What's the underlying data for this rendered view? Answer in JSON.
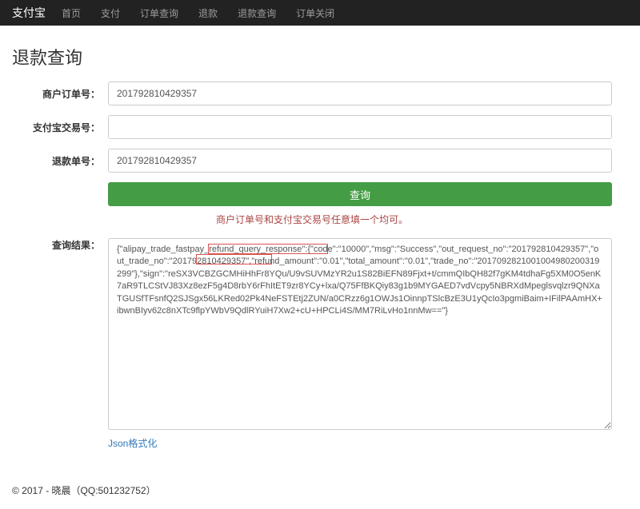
{
  "navbar": {
    "brand": "支付宝",
    "items": [
      {
        "label": "首页"
      },
      {
        "label": "支付"
      },
      {
        "label": "订单查询"
      },
      {
        "label": "退款"
      },
      {
        "label": "退款查询"
      },
      {
        "label": "订单关闭"
      }
    ]
  },
  "page": {
    "title": "退款查询"
  },
  "form": {
    "merchant_order_label": "商户订单号：",
    "merchant_order_value": "201792810429357",
    "alipay_trade_label": "支付宝交易号：",
    "alipay_trade_value": "",
    "refund_order_label": "退款单号：",
    "refund_order_value": "201792810429357",
    "submit_label": "查询",
    "hint": "商户订单号和支付宝交易号任意填一个均可。",
    "result_label": "查询结果：",
    "result_value": "{\"alipay_trade_fastpay_refund_query_response\":{\"code\":\"10000\",\"msg\":\"Success\",\"out_request_no\":\"201792810429357\",\"out_trade_no\":\"201792810429357\",\"refund_amount\":\"0.01\",\"total_amount\":\"0.01\",\"trade_no\":\"2017092821001004980200319299\"},\"sign\":\"reSX3VCBZGCMHiHhFr8YQu/U9vSUVMzYR2u1S82BiEFN89Fjxt+t/cmmQIbQH82f7gKM4tdhaFg5XM0O5enK7aR9TLCStVJ83Xz8ezF5g4D8rbY6rFhItET9zr8YCy+lxa/Q75FfBKQiy83g1b9MYGAED7vdVcpy5NBRXdMpeglsvqlzr9QNXaTGUSfTFsnfQ2SJSgx56LKRed02Pk4NeFSTEtj2ZUN/a0CRzz6g1OWJs1OinnpTSlcBzE3U1yQcIo3pgmiBaim+IFilPAAmHX+ibwnBIyv62c8nXTc9flpYWbV9QdlRYuiH7Xw2+cU+HPCLi4S/MM7RiLvHo1nnMw==\"}",
    "json_format_link": "Json格式化"
  },
  "footer": {
    "text": "© 2017 - 晓晨（QQ:501232752）"
  }
}
